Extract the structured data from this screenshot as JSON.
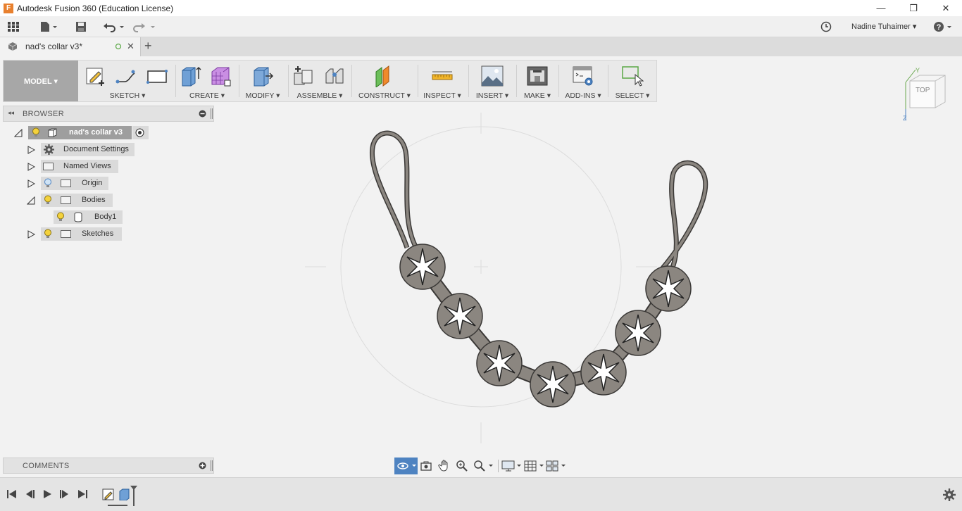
{
  "window": {
    "title": "Autodesk Fusion 360 (Education License)",
    "logo_letter": "F",
    "minimize": "—",
    "maximize": "❐",
    "close": "✕"
  },
  "quick_access": {
    "user_name": "Nadine Tuhaimer ▾",
    "help": "?"
  },
  "tabs": {
    "document_title": "nad's collar v3*",
    "close": "✕",
    "new_tab": "+"
  },
  "toolbar": {
    "workspace": "MODEL ▾",
    "groups": {
      "sketch": "SKETCH ▾",
      "create": "CREATE ▾",
      "modify": "MODIFY ▾",
      "assemble": "ASSEMBLE ▾",
      "construct": "CONSTRUCT ▾",
      "inspect": "INSPECT ▾",
      "insert": "INSERT ▾",
      "make": "MAKE ▾",
      "addins": "ADD-INS ▾",
      "select": "SELECT ▾"
    }
  },
  "browser": {
    "header": "BROWSER",
    "root": "nad's collar v3",
    "items": {
      "document_settings": "Document Settings",
      "named_views": "Named Views",
      "origin": "Origin",
      "bodies": "Bodies",
      "body1": "Body1",
      "sketches": "Sketches"
    }
  },
  "comments": {
    "header": "COMMENTS"
  },
  "viewcube": {
    "face": "TOP",
    "axis_y": "Y",
    "axis_z": "Z"
  },
  "colors": {
    "accent": "#4e83c1",
    "body_fill": "#8b8680",
    "toolbar_bg": "#e9e9e9"
  }
}
